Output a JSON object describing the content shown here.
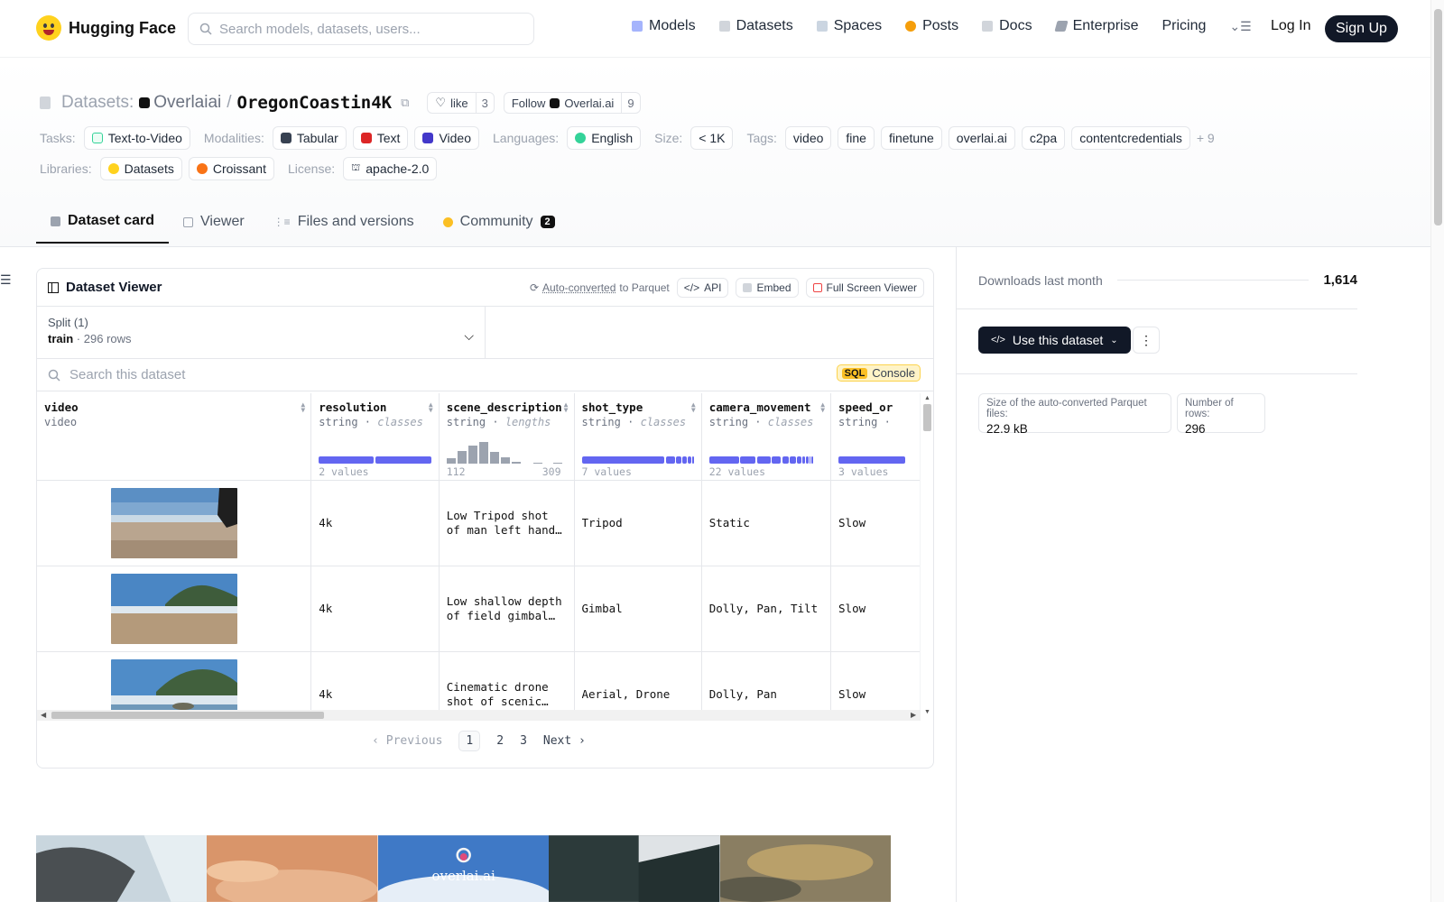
{
  "nav": {
    "brand": "Hugging Face",
    "search_placeholder": "Search models, datasets, users...",
    "items": [
      "Models",
      "Datasets",
      "Spaces",
      "Posts",
      "Docs",
      "Enterprise",
      "Pricing"
    ],
    "login": "Log In",
    "signup": "Sign Up"
  },
  "repo": {
    "section": "Datasets:",
    "org": "Overlaiai",
    "sep": "/",
    "name": "OregonCoastin4K",
    "like_label": "like",
    "like_count": "3",
    "follow_label": "Follow",
    "follow_org": "Overlai.ai",
    "follow_count": "9"
  },
  "tags": {
    "tasks_label": "Tasks:",
    "tasks": [
      "Text-to-Video"
    ],
    "modalities_label": "Modalities:",
    "modalities": [
      "Tabular",
      "Text",
      "Video"
    ],
    "languages_label": "Languages:",
    "languages": [
      "English"
    ],
    "size_label": "Size:",
    "size": "< 1K",
    "tags_label": "Tags:",
    "tags": [
      "video",
      "fine",
      "finetune",
      "overlai.ai",
      "c2pa",
      "contentcredentials"
    ],
    "more": "+ 9",
    "libraries_label": "Libraries:",
    "libraries": [
      "Datasets",
      "Croissant"
    ],
    "license_label": "License:",
    "license": "apache-2.0"
  },
  "tabs": [
    {
      "label": "Dataset card"
    },
    {
      "label": "Viewer"
    },
    {
      "label": "Files and versions"
    },
    {
      "label": "Community",
      "count": "2"
    }
  ],
  "viewer": {
    "title": "Dataset Viewer",
    "autoconverted": "Auto-converted",
    "to_parquet": "to Parquet",
    "api": "API",
    "embed": "Embed",
    "fullscreen": "Full Screen Viewer",
    "split_label": "Split (1)",
    "split_name": "train",
    "split_dot": "·",
    "split_rows": "296 rows",
    "search_placeholder": "Search this dataset",
    "sql": "SQL",
    "console": "Console",
    "columns": [
      {
        "name": "video",
        "type": "video",
        "stat": ""
      },
      {
        "name": "resolution",
        "type": "string",
        "kind": "classes",
        "stat": "2 values"
      },
      {
        "name": "scene_description",
        "type": "string",
        "kind": "lengths",
        "stat": "112",
        "stat2": "309"
      },
      {
        "name": "shot_type",
        "type": "string",
        "kind": "classes",
        "stat": "7 values"
      },
      {
        "name": "camera_movement",
        "type": "string",
        "kind": "classes",
        "stat": "22 values"
      },
      {
        "name": "speed_or",
        "type": "string",
        "kind": "",
        "stat": "3 values"
      }
    ],
    "type_sep": "·",
    "rows": [
      {
        "resolution": "4k",
        "scene_description": "Low Tripod shot of man left hand…",
        "shot_type": "Tripod",
        "camera_movement": "Static",
        "speed": "Slow"
      },
      {
        "resolution": "4k",
        "scene_description": "Low shallow depth of field gimbal…",
        "shot_type": "Gimbal",
        "camera_movement": "Dolly, Pan, Tilt",
        "speed": "Slow"
      },
      {
        "resolution": "4k",
        "scene_description": "Cinematic drone shot of scenic…",
        "shot_type": "Aerial, Drone",
        "camera_movement": "Dolly, Pan",
        "speed": "Slow"
      }
    ],
    "pager": {
      "prev": "Previous",
      "pages": [
        "1",
        "2",
        "3"
      ],
      "next": "Next"
    }
  },
  "sidebar": {
    "downloads_label": "Downloads last month",
    "downloads": "1,614",
    "use_button": "Use this dataset",
    "parquet_size_label": "Size of the auto-converted Parquet files:",
    "parquet_size": "22.9 kB",
    "rows_label": "Number of rows:",
    "rows": "296"
  },
  "gallery_logo_text": "overlai.ai",
  "colors": {
    "accent": "#6366f1",
    "dark": "#111827",
    "sql": "#fbbf24"
  }
}
